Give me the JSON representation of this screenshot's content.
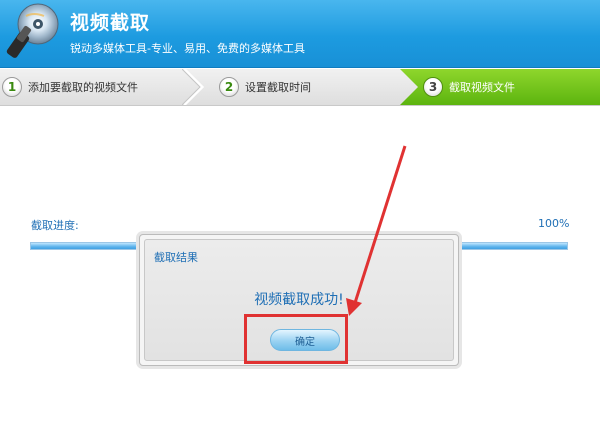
{
  "app": {
    "title": "视频截取",
    "subtitle": "锐动多媒体工具-专业、易用、免费的多媒体工具",
    "logo_icon": "disc-with-scissors-icon"
  },
  "steps": [
    {
      "number": "1",
      "label": "添加要截取的视频文件",
      "active": false
    },
    {
      "number": "2",
      "label": "设置截取时间",
      "active": false
    },
    {
      "number": "3",
      "label": "截取视频文件",
      "active": true
    }
  ],
  "progress": {
    "label": "截取进度:",
    "percent_text": "100%",
    "value": 100
  },
  "dialog": {
    "title": "截取结果",
    "message": "视频截取成功!",
    "ok_label": "确定"
  },
  "colors": {
    "header_blue": "#1d9be0",
    "active_step_green": "#6cc41a",
    "accent_text": "#1f6fb5",
    "annotation_red": "#e03232"
  }
}
